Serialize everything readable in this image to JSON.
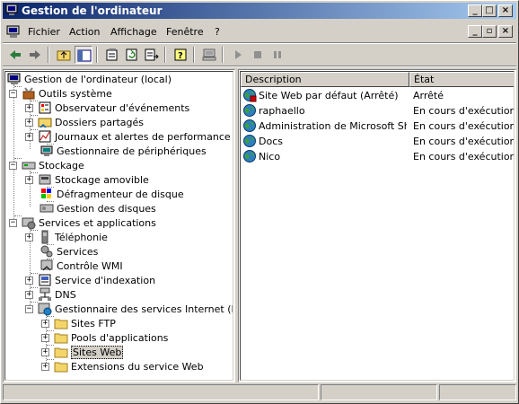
{
  "window": {
    "title": "Gestion de l'ordinateur",
    "controls": [
      "_",
      "□",
      "×"
    ]
  },
  "menu": {
    "items": [
      {
        "label": "Fichier"
      },
      {
        "label": "Action"
      },
      {
        "label": "Affichage"
      },
      {
        "label": "Fenêtre"
      },
      {
        "label": "?"
      }
    ],
    "mdi_controls": [
      "_",
      "▫",
      "×"
    ]
  },
  "tree": {
    "items": [
      {
        "label": "Gestion de l'ordinateur (local)",
        "icon": "computer-icon"
      },
      {
        "label": "Outils système",
        "icon": "tools-icon",
        "state": "expanded"
      },
      {
        "label": "Observateur d'événements",
        "icon": "event-viewer-icon",
        "state": "collapsed"
      },
      {
        "label": "Dossiers partagés",
        "icon": "shared-folder-icon",
        "state": "collapsed"
      },
      {
        "label": "Journaux et alertes de performance",
        "icon": "performance-icon",
        "state": "collapsed"
      },
      {
        "label": "Gestionnaire de périphériques",
        "icon": "device-manager-icon"
      },
      {
        "label": "Stockage",
        "icon": "storage-icon",
        "state": "expanded"
      },
      {
        "label": "Stockage amovible",
        "icon": "removable-storage-icon",
        "state": "collapsed"
      },
      {
        "label": "Défragmenteur de disque",
        "icon": "defrag-icon"
      },
      {
        "label": "Gestion des disques",
        "icon": "disk-management-icon"
      },
      {
        "label": "Services et applications",
        "icon": "services-apps-icon",
        "state": "expanded"
      },
      {
        "label": "Téléphonie",
        "icon": "telephony-icon",
        "state": "collapsed"
      },
      {
        "label": "Services",
        "icon": "services-icon"
      },
      {
        "label": "Contrôle WMI",
        "icon": "wmi-icon"
      },
      {
        "label": "Service d'indexation",
        "icon": "indexing-icon",
        "state": "collapsed"
      },
      {
        "label": "DNS",
        "icon": "dns-icon",
        "state": "collapsed"
      },
      {
        "label": "Gestionnaire des services Internet (IIS)",
        "icon": "iis-icon",
        "state": "expanded"
      },
      {
        "label": "Sites FTP",
        "icon": "folder-icon",
        "state": "collapsed"
      },
      {
        "label": "Pools d'applications",
        "icon": "folder-icon",
        "state": "collapsed"
      },
      {
        "label": "Sites Web",
        "icon": "folder-icon",
        "state": "collapsed",
        "selected": true
      },
      {
        "label": "Extensions du service Web",
        "icon": "folder-icon",
        "state": "collapsed"
      }
    ]
  },
  "list": {
    "columns": [
      {
        "label": "Description"
      },
      {
        "label": "État"
      }
    ],
    "rows": [
      {
        "description": "Site Web par défaut (Arrêté)",
        "state": "Arrêté",
        "icon": "website-stopped-icon"
      },
      {
        "description": "raphaello",
        "state": "En cours d'exécution",
        "icon": "website-icon"
      },
      {
        "description": "Administration de Microsoft Sha...",
        "state": "En cours d'exécution",
        "icon": "website-icon"
      },
      {
        "description": "Docs",
        "state": "En cours d'exécution",
        "icon": "website-icon"
      },
      {
        "description": "Nico",
        "state": "En cours d'exécution",
        "icon": "website-icon"
      }
    ]
  },
  "colors": {
    "title_start": "#0a246a",
    "title_end": "#a6caf0",
    "face": "#d4d0c8"
  }
}
